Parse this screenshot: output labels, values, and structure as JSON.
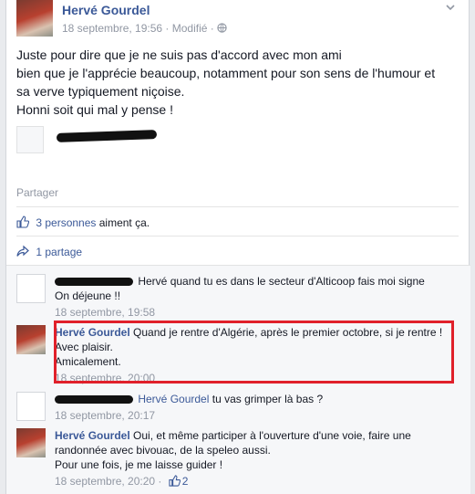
{
  "post": {
    "author": "Hervé Gourdel",
    "date": "18 septembre, 19:56",
    "edited": "Modifié",
    "lines": [
      "Juste pour dire que je ne suis pas d'accord avec mon ami",
      "bien que je l'apprécie beaucoup, notamment pour son sens de l'humour et",
      "sa verve typiquement niçoise.",
      "Honni soit qui mal y pense !"
    ]
  },
  "actions": {
    "share": "Partager"
  },
  "likes": {
    "count_link": "3 personnes",
    "suffix": "aiment ça."
  },
  "shares": {
    "label": "1 partage"
  },
  "comments": [
    {
      "author": "",
      "text": "Hervé quand tu es dans le secteur d'Alticoop fais moi signe",
      "text2": "On déjeune !!",
      "time": "18 septembre, 19:58"
    },
    {
      "author": "Hervé Gourdel",
      "text": "Quand je rentre d'Algérie, après le premier octobre, si je rentre !",
      "text2": "Avec plaisir.",
      "text3": "Amicalement.",
      "time": "18 septembre, 20:00"
    },
    {
      "author": "Hervé Gourdel",
      "text": "tu vas grimper là bas ?",
      "time": "18 septembre, 20:17"
    },
    {
      "author": "Hervé Gourdel",
      "text": "Oui, et même participer à l'ouverture d'une voie, faire une",
      "text2": "randonnée avec bivouac, de la speleo aussi.",
      "text3": "Pour une fois, je me laisse guider !",
      "time": "18 septembre, 20:20",
      "likes": "2"
    }
  ],
  "colors": {
    "link": "#3b5998",
    "meta": "#9197a3",
    "highlight": "#e0202a"
  },
  "icons": {
    "audience": "globe-icon",
    "menu": "chevron-down-icon",
    "like": "thumbs-up-icon",
    "share": "share-arrow-icon"
  }
}
